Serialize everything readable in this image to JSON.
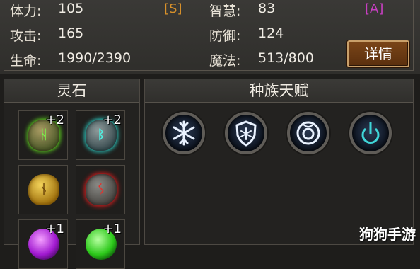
{
  "stats": {
    "strength": {
      "label": "体力:",
      "value": "105",
      "grade": "[S]"
    },
    "wisdom": {
      "label": "智慧:",
      "value": "83",
      "grade": "[A]"
    },
    "attack": {
      "label": "攻击:",
      "value": "165"
    },
    "defense": {
      "label": "防御:",
      "value": "124"
    },
    "hp": {
      "label": "生命:",
      "value": "1990/2390"
    },
    "mana": {
      "label": "魔法:",
      "value": "513/800"
    },
    "detail_button": "详情"
  },
  "colors": {
    "grade_s": "#d9912a",
    "grade_a": "#c73fc1"
  },
  "rune_panel": {
    "title": "灵石",
    "slots": [
      {
        "icon": "green-rune-stone-icon",
        "badge": "+2"
      },
      {
        "icon": "teal-rune-stone-icon",
        "badge": "+2"
      },
      {
        "icon": "gold-rune-stone-icon",
        "badge": ""
      },
      {
        "icon": "red-rune-stone-icon",
        "badge": ""
      },
      {
        "icon": "purple-orb-icon",
        "badge": "+1"
      },
      {
        "icon": "green-orb-icon",
        "badge": "+1"
      }
    ]
  },
  "talent_panel": {
    "title": "种族天赋",
    "talents": [
      {
        "icon": "snowflake-icon"
      },
      {
        "icon": "frost-shield-icon"
      },
      {
        "icon": "mana-ring-icon"
      },
      {
        "icon": "power-symbol-icon"
      }
    ]
  },
  "watermark": "狗狗手游"
}
